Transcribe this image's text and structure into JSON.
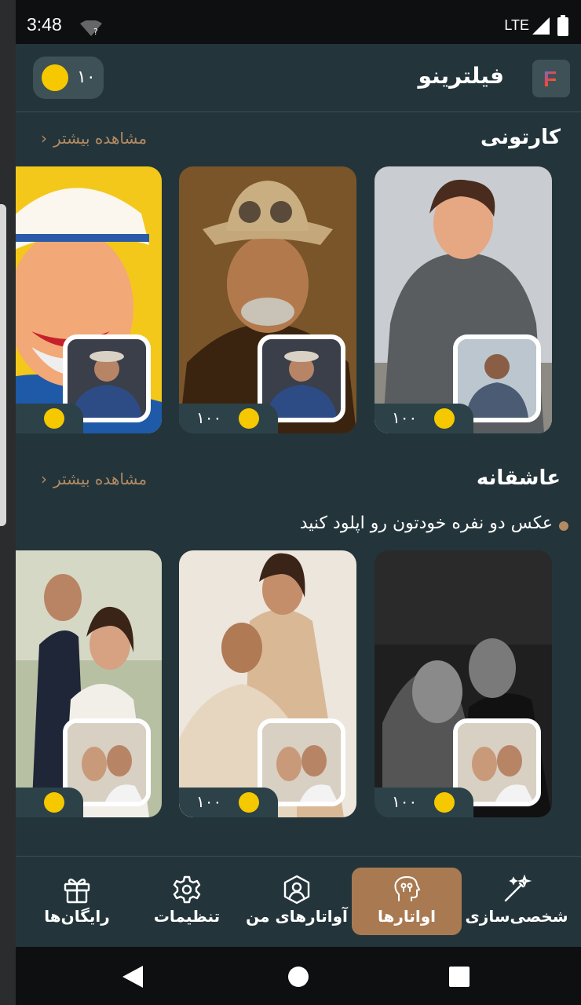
{
  "status": {
    "time": "3:48",
    "network": "LTE"
  },
  "header": {
    "app_title": "فیلترینو",
    "logo_letter": "F",
    "coin_balance": "۱۰"
  },
  "sections": [
    {
      "title": "کارتونی",
      "see_more": "مشاهده بیشتر",
      "cards": [
        {
          "price": "۱۰۰",
          "style": "3d-cartoon"
        },
        {
          "price": "۱۰۰",
          "style": "steampunk"
        },
        {
          "price": "",
          "style": "pop-art"
        }
      ]
    },
    {
      "title": "عاشقانه",
      "see_more": "مشاهده بیشتر",
      "note": "عکس دو نفره خودتون رو اپلود کنید",
      "cards": [
        {
          "price": "۱۰۰",
          "style": "black-white-car"
        },
        {
          "price": "۱۰۰",
          "style": "studio-beige"
        },
        {
          "price": "",
          "style": "wedding"
        }
      ]
    }
  ],
  "bottom_nav": [
    {
      "label": "شخصی‌سازی",
      "icon": "magic-wand-icon",
      "active": false
    },
    {
      "label": "اواتارها",
      "icon": "avatar-face-icon",
      "active": true
    },
    {
      "label": "آواتارهای من",
      "icon": "user-icon",
      "active": false
    },
    {
      "label": "تنظیمات",
      "icon": "gear-icon",
      "active": false
    },
    {
      "label": "رایگان‌ها",
      "icon": "gift-icon",
      "active": false
    }
  ],
  "colors": {
    "background": "#23353b",
    "accent": "#a97a52",
    "coin": "#f5c800"
  }
}
